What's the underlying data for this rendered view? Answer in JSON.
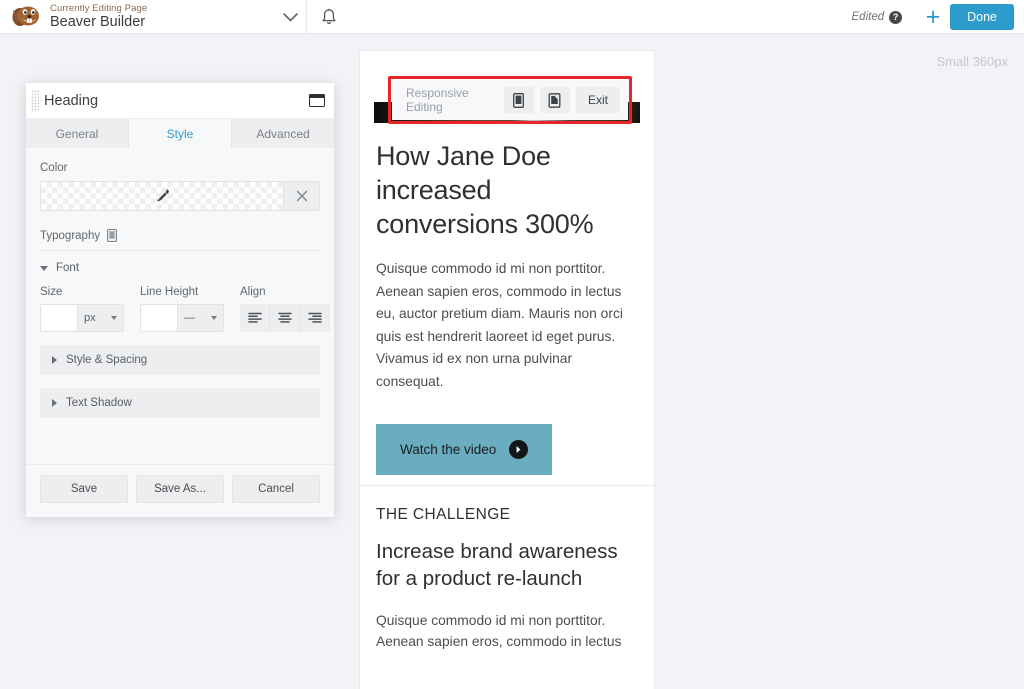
{
  "topbar": {
    "logo_icon": "beaver-logo-icon",
    "subtitle": "Currently Editing Page",
    "title": "Beaver Builder",
    "caret_icon": "chevron-down-icon",
    "bell_icon": "bell-icon",
    "edited_label": "Edited",
    "help_glyph": "?",
    "plus_glyph": "+",
    "done_label": "Done"
  },
  "responsive": {
    "label": "Responsive Editing",
    "medium_icon": "tablet-device-icon",
    "small_icon": "mobile-device-icon",
    "exit_label": "Exit",
    "size_label": "Small 360px",
    "highlight_color": "#e8262a"
  },
  "panel": {
    "title": "Heading",
    "dock_icon": "dock-window-icon",
    "drag_handle": "drag-handle-icon",
    "tabs": [
      {
        "label": "General",
        "active": false
      },
      {
        "label": "Style",
        "active": true
      },
      {
        "label": "Advanced",
        "active": false
      }
    ],
    "color": {
      "label": "Color",
      "value": "",
      "eyedropper_icon": "eyedropper-icon",
      "clear_icon": "close-icon"
    },
    "typography": {
      "label": "Typography",
      "responsive_icon": "mobile-device-icon"
    },
    "font_section": {
      "label": "Font",
      "expanded": true,
      "size": {
        "label": "Size",
        "value": "",
        "unit": "px"
      },
      "line_height": {
        "label": "Line Height",
        "value": "",
        "unit": "—"
      },
      "align": {
        "label": "Align",
        "options": [
          "align-left-icon",
          "align-center-icon",
          "align-right-icon"
        ]
      }
    },
    "accordions": [
      {
        "label": "Style & Spacing",
        "expanded": false
      },
      {
        "label": "Text Shadow",
        "expanded": false
      }
    ],
    "footer": {
      "save_label": "Save",
      "save_as_label": "Save As...",
      "cancel_label": "Cancel"
    }
  },
  "preview": {
    "hero_image": "hero-photo",
    "heading": "How Jane Doe increased conversions 300%",
    "paragraph": "Quisque commodo id mi non porttitor. Aenean sapien eros, commodo in lectus eu, auctor pretium diam. Mauris non orci quis est hendrerit laoreet id eget purus. Vivamus id ex non urna pulvinar consequat.",
    "cta_label": "Watch the video",
    "cta_icon": "arrow-right-circle-icon",
    "cta_color": "#6aadc0",
    "kicker": "THE CHALLENGE",
    "subheading": "Increase brand awareness for a product re-launch",
    "paragraph2": "Quisque commodo id mi non porttitor. Aenean sapien eros, commodo in lectus"
  }
}
